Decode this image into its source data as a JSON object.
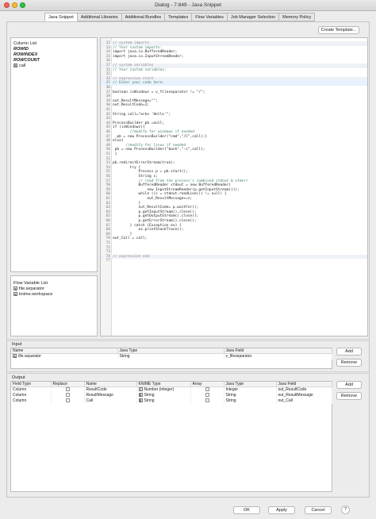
{
  "window": {
    "title": "Dialog - 7:849 - Java Snippet"
  },
  "tabs": [
    {
      "label": "Java Snippet",
      "active": true
    },
    {
      "label": "Additional Libraries",
      "active": false
    },
    {
      "label": "Additional Bundles",
      "active": false
    },
    {
      "label": "Templates",
      "active": false
    },
    {
      "label": "Flow Variables",
      "active": false
    },
    {
      "label": "Job Manager Selection",
      "active": false
    },
    {
      "label": "Memory Policy",
      "active": false
    }
  ],
  "toolbar": {
    "create_template_label": "Create Template..."
  },
  "column_list": {
    "title": "Column List",
    "items": [
      {
        "label": "ROWID",
        "type": "special"
      },
      {
        "label": "ROWINDEX",
        "type": "special"
      },
      {
        "label": "ROWCOUNT",
        "type": "special"
      },
      {
        "label": "call",
        "type": "string",
        "icon": "S"
      }
    ]
  },
  "flow_variable_list": {
    "title": "Flow Variable List",
    "items": [
      {
        "label": "file.separator",
        "icon": "s"
      },
      {
        "label": "knime.workspace",
        "icon": "s"
      }
    ]
  },
  "code_lines": [
    {
      "n": "12",
      "t": "// system imports",
      "style": "guarded"
    },
    {
      "n": "13",
      "t": "// Your custom imports:",
      "style": "comment"
    },
    {
      "n": "14",
      "t": "import java.io.BufferedReader;",
      "style": "code"
    },
    {
      "n": "15",
      "t": "import java.io.InputStreamReader;",
      "style": "code"
    },
    {
      "n": "16",
      "t": "",
      "style": "code"
    },
    {
      "n": "17",
      "t": "// system variables",
      "style": "guarded"
    },
    {
      "n": "31",
      "t": "// Your custom variables:",
      "style": "comment"
    },
    {
      "n": "32",
      "t": "",
      "style": "code"
    },
    {
      "n": "33",
      "t": "// expression start",
      "style": "guarded"
    },
    {
      "n": "35",
      "t": "// Enter your code here:",
      "style": "comment-hl"
    },
    {
      "n": "36",
      "t": "",
      "style": "code"
    },
    {
      "n": "37",
      "t": "boolean isWindows = v_fileseparator != \"/\";",
      "style": "code"
    },
    {
      "n": "38",
      "t": "",
      "style": "code"
    },
    {
      "n": "39",
      "t": "out_ResultMessage=\"\";",
      "style": "code"
    },
    {
      "n": "40",
      "t": "out_ResultCode=1;",
      "style": "code"
    },
    {
      "n": "41",
      "t": "",
      "style": "code"
    },
    {
      "n": "42",
      "t": "String call=\"echo 'Hello'\";",
      "style": "code"
    },
    {
      "n": "43",
      "t": "",
      "style": "code"
    },
    {
      "n": "44",
      "t": "ProcessBuilder pb =null;",
      "style": "code"
    },
    {
      "n": "45",
      "t": "if (isWindows){",
      "style": "code"
    },
    {
      "n": "46",
      "t": "        //modify for windows if needed",
      "style": "comment"
    },
    {
      "n": "47",
      "t": "  pb = new ProcessBuilder(\"cmd\",\"/C\",call);}",
      "style": "code"
    },
    {
      "n": "48",
      "t": "else{",
      "style": "code"
    },
    {
      "n": "49",
      "t": "      //modify for linux if needed",
      "style": "comment"
    },
    {
      "n": "50",
      "t": " pb = new ProcessBuilder(\"bash\",\"-c\",call);",
      "style": "code"
    },
    {
      "n": "51",
      "t": " }",
      "style": "code"
    },
    {
      "n": "52",
      "t": "",
      "style": "code"
    },
    {
      "n": "53",
      "t": "pb.redirectErrorStream(true);",
      "style": "code"
    },
    {
      "n": "54",
      "t": "        try {",
      "style": "code"
    },
    {
      "n": "55",
      "t": "            Process p = pb.start();",
      "style": "code"
    },
    {
      "n": "56",
      "t": "            String s;",
      "style": "code"
    },
    {
      "n": "57",
      "t": "            // read from the process's combined stdout & stderr",
      "style": "comment"
    },
    {
      "n": "58",
      "t": "            BufferedReader stdout = new BufferedReader(",
      "style": "code"
    },
    {
      "n": "59",
      "t": "                new InputStreamReader(p.getInputStream()));",
      "style": "code"
    },
    {
      "n": "60",
      "t": "            while ((s = stdout.readLine()) != null) {",
      "style": "code"
    },
    {
      "n": "61",
      "t": "                out_ResultMessage+=s;",
      "style": "code"
    },
    {
      "n": "62",
      "t": "            }",
      "style": "code"
    },
    {
      "n": "63",
      "t": "            out_ResultCode= p.waitFor();",
      "style": "code"
    },
    {
      "n": "64",
      "t": "            p.getInputStream().close();",
      "style": "code"
    },
    {
      "n": "65",
      "t": "            p.getOutputStream().close();",
      "style": "code"
    },
    {
      "n": "66",
      "t": "            p.getErrorStream().close();",
      "style": "code"
    },
    {
      "n": "67",
      "t": "        } catch (Exception ex) {",
      "style": "code"
    },
    {
      "n": "68",
      "t": "            ex.printStackTrace();",
      "style": "code"
    },
    {
      "n": "69",
      "t": "        }",
      "style": "code"
    },
    {
      "n": "70",
      "t": "out_Call = call;",
      "style": "code"
    },
    {
      "n": "71",
      "t": "",
      "style": "code"
    },
    {
      "n": "72",
      "t": "",
      "style": "code"
    },
    {
      "n": "73",
      "t": "",
      "style": "code"
    },
    {
      "n": "74",
      "t": "// expression end",
      "style": "guarded"
    },
    {
      "n": "77",
      "t": "",
      "style": "code"
    }
  ],
  "input": {
    "title": "Input",
    "headers": [
      "Name",
      "Java Type",
      "Java Field"
    ],
    "rows": [
      {
        "name": "file.separator",
        "icon": "s",
        "java_type": "String",
        "java_field": "v_fileseparator"
      }
    ],
    "add_label": "Add",
    "remove_label": "Remove"
  },
  "output": {
    "title": "Output",
    "headers": [
      "Field Type",
      "Replace",
      "Name",
      "KNIME Type",
      "Array",
      "Java Type",
      "Java Field"
    ],
    "rows": [
      {
        "field_type": "Column",
        "name": "ResultCode",
        "knime_icon": "I",
        "knime_type": "Number (integer)",
        "java_type": "Integer",
        "java_field": "out_ResultCode"
      },
      {
        "field_type": "Column",
        "name": "ResultMessage",
        "knime_icon": "S",
        "knime_type": "String",
        "java_type": "String",
        "java_field": "out_ResultMessage"
      },
      {
        "field_type": "Column",
        "name": "Call",
        "knime_icon": "S",
        "knime_type": "String",
        "java_type": "String",
        "java_field": "out_Call"
      }
    ],
    "add_label": "Add",
    "remove_label": "Remove"
  },
  "footer": {
    "ok_label": "OK",
    "apply_label": "Apply",
    "cancel_label": "Cancel",
    "help_label": "?"
  },
  "colors": {
    "close": "#fe5f57",
    "minimize": "#febc2e",
    "maximize": "#28c840",
    "highlight_line": "#e8f2fe",
    "guarded_line": "#eef1f6"
  }
}
